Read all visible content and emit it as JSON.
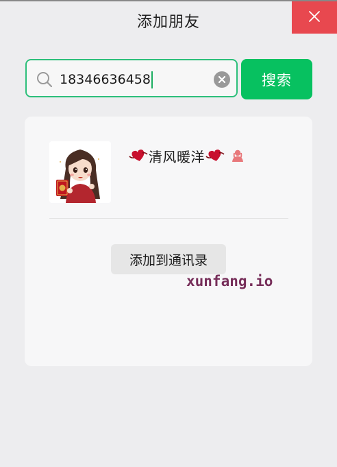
{
  "window": {
    "title": "添加朋友",
    "close_icon": "close-icon"
  },
  "search": {
    "query": "18346636458",
    "search_icon": "search-icon",
    "clear_icon": "clear-circle-icon",
    "button_label": "搜索"
  },
  "result": {
    "avatar": "avatar-image",
    "nickname": "清风暖洋",
    "decorations": [
      "heart-icon",
      "heart-icon"
    ],
    "gender_icon": "female-person-icon",
    "add_button_label": "添加到通讯录"
  },
  "watermark": {
    "text": "xunfang.io"
  },
  "colors": {
    "accent_green": "#07c160",
    "close_red": "#e8484f",
    "heart_red": "#c8102e",
    "gender_pink": "#e8787b",
    "watermark": "#6a1a4a"
  }
}
